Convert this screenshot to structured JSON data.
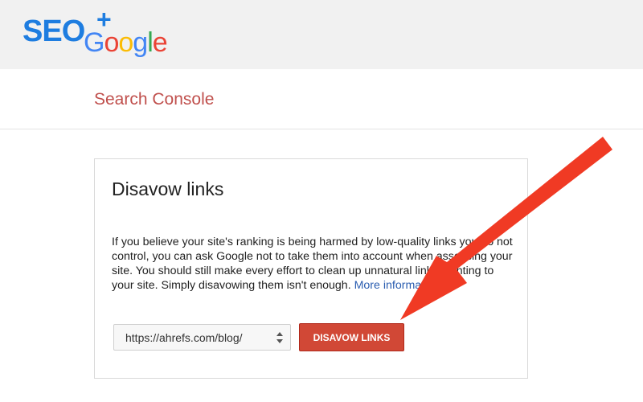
{
  "brand": {
    "seo": "SEO",
    "plus": "+",
    "google_letters": [
      "G",
      "o",
      "o",
      "g",
      "l",
      "e"
    ]
  },
  "header": {
    "console_title": "Search Console"
  },
  "dialog": {
    "title": "Disavow links",
    "body_text": "If you believe your site's ranking is being harmed by low-quality links you do not control, you can ask Google not to take them into account when assessing your site. You should still make every effort to clean up unnatural links pointing to your site. Simply disavowing them isn't enough.",
    "more_info_link": "More information.",
    "url_select_value": "https://ahrefs.com/blog/",
    "disavow_button_label": "DISAVOW LINKS"
  },
  "colors": {
    "brand_blue": "#1e7de0",
    "console_title": "#c0504d",
    "button_red": "#d14836",
    "arrow_red": "#f03a24",
    "link_blue": "#2a5db0"
  },
  "icons": {
    "select_arrows": "updown-icon",
    "annotation": "arrow-icon"
  }
}
